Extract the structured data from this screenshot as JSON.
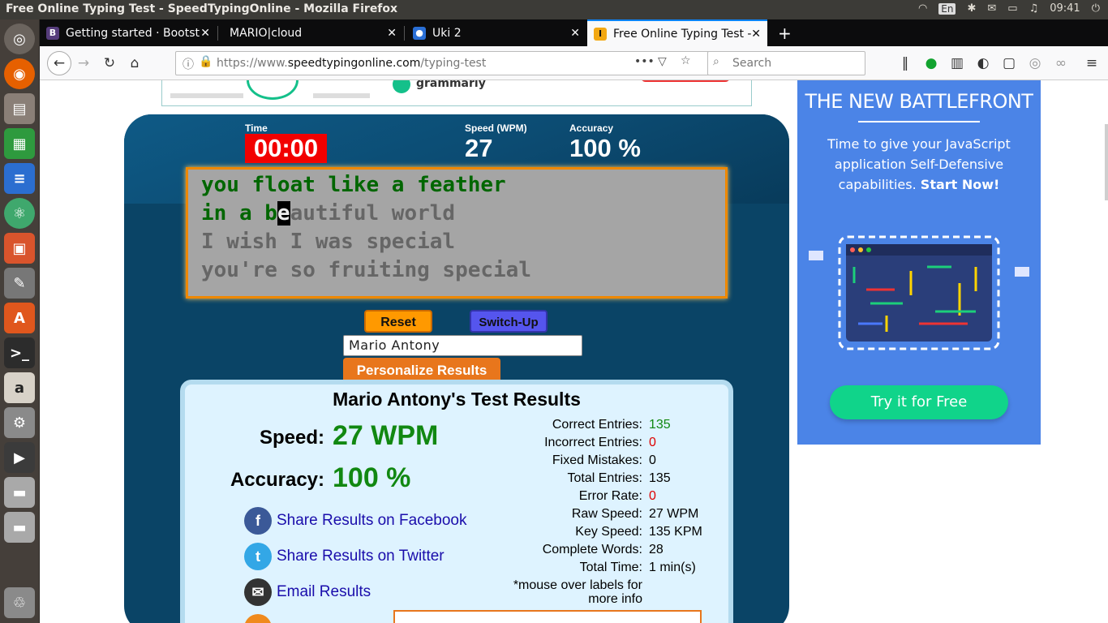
{
  "window": {
    "title": "Free Online Typing Test - SpeedTypingOnline - Mozilla Firefox",
    "clock": "09:41",
    "kbd": "En"
  },
  "tabs": [
    {
      "label": "Getting started · Bootst",
      "icon": "B",
      "color": "#563d7c"
    },
    {
      "label": "MARIO|cloud",
      "icon": "",
      "color": ""
    },
    {
      "label": "Uki 2",
      "icon": "",
      "color": "#2a6fd6"
    },
    {
      "label": "Free Online Typing Test -",
      "icon": "I",
      "color": "#f3a812"
    }
  ],
  "url": {
    "prefix": "https://www.",
    "domain": "speedtypingonline.com",
    "path": "/typing-test"
  },
  "search": {
    "placeholder": "Search"
  },
  "ad_top": {
    "brand": "grammarly"
  },
  "stats": {
    "time_label": "Time",
    "time_value": "00:00",
    "speed_label": "Speed (WPM)",
    "speed_value": "27",
    "accuracy_label": "Accuracy",
    "accuracy_value": "100 %"
  },
  "typing": {
    "line1": "you float like a feather",
    "line2_done": "in a b",
    "line2_cursor": "e",
    "line2_rest": "autiful world",
    "line3": "I wish I was special",
    "line4": "you're so fruiting special"
  },
  "controls": {
    "reset": "Reset",
    "switchup": "Switch-Up",
    "name": "Mario Antony",
    "personalize": "Personalize Results"
  },
  "results": {
    "title": "Mario Antony's Test Results",
    "speed_label": "Speed:",
    "speed_value": "27 WPM",
    "accuracy_label": "Accuracy:",
    "accuracy_value": "100 %",
    "stats": [
      {
        "label": "Correct Entries:",
        "value": "135",
        "color": "#118811"
      },
      {
        "label": "Incorrect Entries:",
        "value": "0",
        "color": "#dd0000"
      },
      {
        "label": "Fixed Mistakes:",
        "value": "0",
        "color": "#000000"
      },
      {
        "label": "Total Entries:",
        "value": "135",
        "color": "#000000"
      },
      {
        "label": "Error Rate:",
        "value": "0",
        "color": "#dd0000"
      },
      {
        "label": "Raw Speed:",
        "value": "27 WPM",
        "color": "#000000"
      },
      {
        "label": "Key Speed:",
        "value": "135 KPM",
        "color": "#000000"
      },
      {
        "label": "Complete Words:",
        "value": "28",
        "color": "#000000"
      },
      {
        "label": "Total Time:",
        "value": "1 min(s)",
        "color": "#000000"
      }
    ],
    "note": "*mouse over labels for",
    "note2": "more info",
    "share_facebook": "Share Results on Facebook",
    "share_twitter": "Share Results on Twitter",
    "share_email": "Email Results"
  },
  "side_ad": {
    "heading": "THE NEW BATTLEFRONT",
    "text": "Time to give your JavaScript application Self-Defensive capabilities.",
    "text_strong": "Start Now!",
    "cta": "Try it for Free"
  }
}
